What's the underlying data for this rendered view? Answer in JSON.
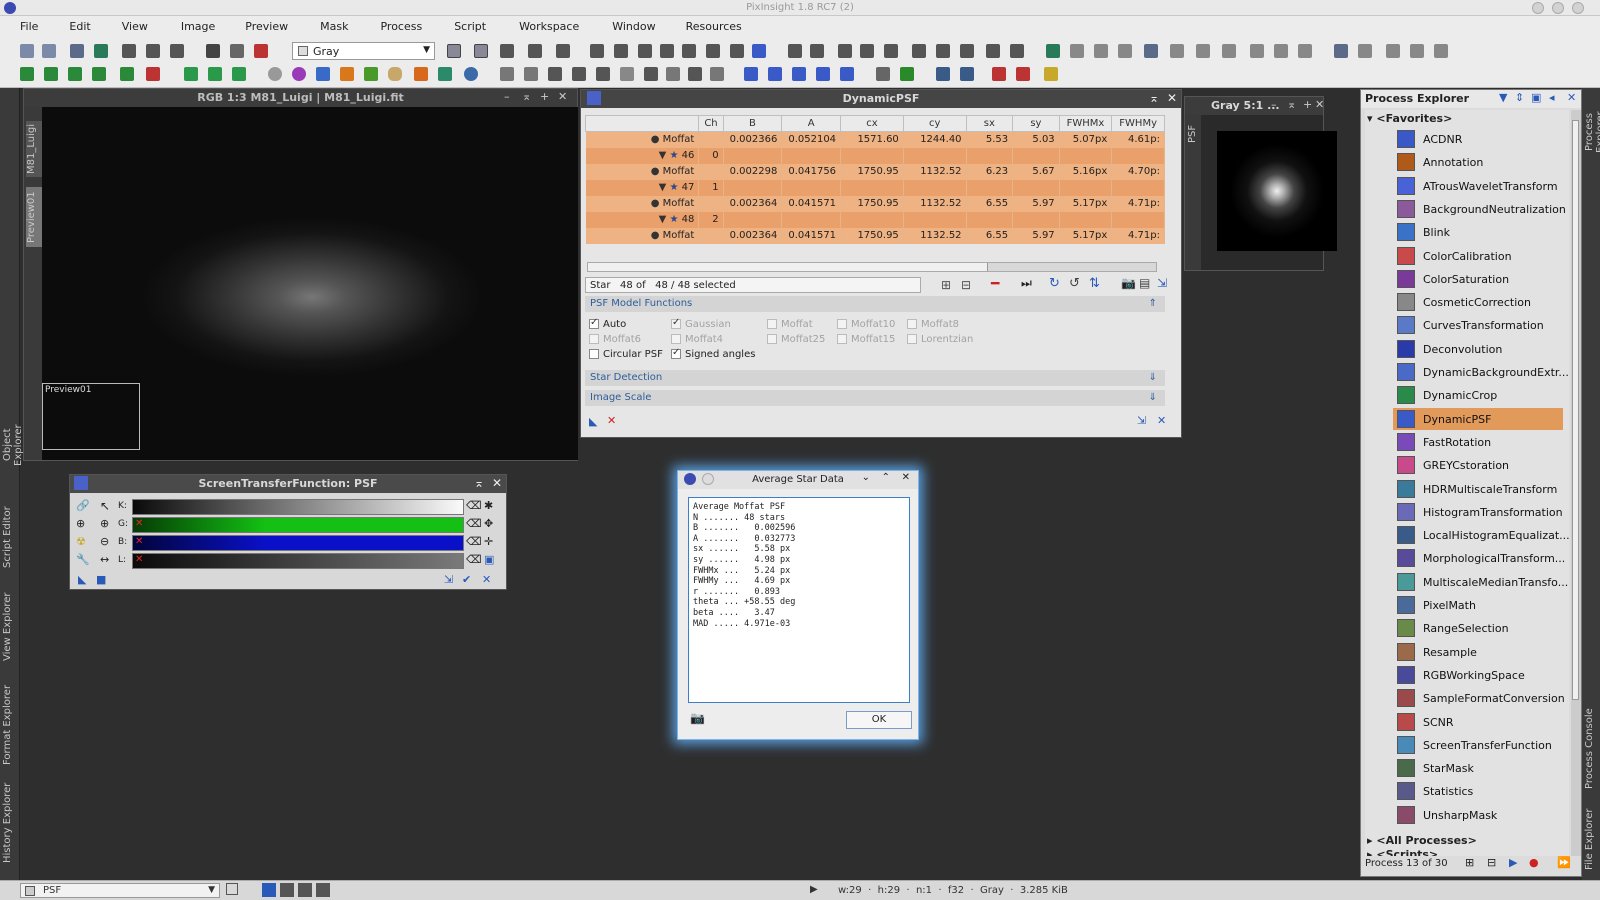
{
  "app": {
    "title": "PixInsight 1.8 RC7 (2)"
  },
  "menu": [
    "File",
    "Edit",
    "View",
    "Image",
    "Preview",
    "Mask",
    "Process",
    "Script",
    "Workspace",
    "Window",
    "Resources"
  ],
  "toolbar": {
    "color_space": "Gray"
  },
  "image_window": {
    "title": "RGB 1:3 M81_Luigi | M81_Luigi.fit",
    "tab_main": "M81_Luigi",
    "tab_preview": "Preview01",
    "preview_label": "Preview01"
  },
  "left_dock": [
    "Object Explorer",
    "Script Editor",
    "View Explorer",
    "Format Explorer",
    "History Explorer"
  ],
  "right_dock": [
    "Process Explorer",
    "Process Console",
    "File Explorer"
  ],
  "stf": {
    "title": "ScreenTransferFunction: PSF",
    "rows": [
      {
        "label": "K:"
      },
      {
        "label": "G:"
      },
      {
        "label": "B:"
      },
      {
        "label": "L:"
      }
    ],
    "colors": {
      "K": "#1a1a1a",
      "G": "#13c013",
      "B": "#0a10c8",
      "L": "#1a1a1a"
    }
  },
  "dpsf": {
    "title": "DynamicPSF",
    "columns": [
      "",
      "Ch",
      "B",
      "A",
      "cx",
      "cy",
      "sx",
      "sy",
      "FWHMx",
      "FWHMy"
    ],
    "rows": [
      {
        "kind": "data",
        "func": "Moffat",
        "B": "0.002366",
        "A": "0.052104",
        "cx": "1571.60",
        "cy": "1244.40",
        "sx": "5.53",
        "sy": "5.03",
        "fx": "5.07px",
        "fy": "4.61p:"
      },
      {
        "kind": "star",
        "id": "46",
        "ch": "0"
      },
      {
        "kind": "data",
        "func": "Moffat",
        "B": "0.002298",
        "A": "0.041756",
        "cx": "1750.95",
        "cy": "1132.52",
        "sx": "6.23",
        "sy": "5.67",
        "fx": "5.16px",
        "fy": "4.70p:"
      },
      {
        "kind": "star",
        "id": "47",
        "ch": "1"
      },
      {
        "kind": "data",
        "func": "Moffat",
        "B": "0.002364",
        "A": "0.041571",
        "cx": "1750.95",
        "cy": "1132.52",
        "sx": "6.55",
        "sy": "5.97",
        "fx": "5.17px",
        "fy": "4.71p:"
      },
      {
        "kind": "star",
        "id": "48",
        "ch": "2"
      },
      {
        "kind": "data",
        "func": "Moffat",
        "B": "0.002364",
        "A": "0.041571",
        "cx": "1750.95",
        "cy": "1132.52",
        "sx": "6.55",
        "sy": "5.97",
        "fx": "5.17px",
        "fy": "4.71p:"
      }
    ],
    "status": "Star   48 of   48 / 48 selected",
    "sections": {
      "model": "PSF Model Functions",
      "detection": "Star Detection",
      "scale": "Image Scale"
    },
    "options": {
      "auto": "Auto",
      "gaussian": "Gaussian",
      "moffat": "Moffat",
      "moffat10": "Moffat10",
      "moffat8": "Moffat8",
      "moffat6": "Moffat6",
      "moffat4": "Moffat4",
      "moffat25": "Moffat25",
      "moffat15": "Moffat15",
      "lorentzian": "Lorentzian",
      "circular": "Circular PSF",
      "signed": "Signed angles"
    }
  },
  "gray_window": {
    "title": "Gray 5:1 ...",
    "tab": "PSF"
  },
  "avg_dialog": {
    "title": "Average Star Data",
    "lines": [
      "Average Moffat PSF",
      "N ....... 48 stars",
      "B .......   0.002596",
      "A .......   0.032773",
      "sx ......   5.58 px",
      "sy ......   4.98 px",
      "FWHMx ...   5.24 px",
      "FWHMy ...   4.69 px",
      "r .......   0.893",
      "theta ... +58.55 deg",
      "beta ....   3.47",
      "MAD ..... 4.971e-03"
    ],
    "ok": "OK"
  },
  "process_explorer": {
    "title": "Process Explorer",
    "favorites": "<Favorites>",
    "items": [
      "ACDNR",
      "Annotation",
      "ATrousWaveletTransform",
      "BackgroundNeutralization",
      "Blink",
      "ColorCalibration",
      "ColorSaturation",
      "CosmeticCorrection",
      "CurvesTransformation",
      "Deconvolution",
      "DynamicBackgroundExtr...",
      "DynamicCrop",
      "DynamicPSF",
      "FastRotation",
      "GREYCstoration",
      "HDRMultiscaleTransform",
      "HistogramTransformation",
      "LocalHistogramEqualizat...",
      "MorphologicalTransform...",
      "MultiscaleMedianTransfo...",
      "PixelMath",
      "RangeSelection",
      "Resample",
      "RGBWorkingSpace",
      "SampleFormatConversion",
      "SCNR",
      "ScreenTransferFunction",
      "StarMask",
      "Statistics",
      "UnsharpMask"
    ],
    "icon_colors": [
      "#3a58c8",
      "#b05a1a",
      "#4a62d8",
      "#8a5a9a",
      "#3a72c8",
      "#c84a4a",
      "#7a3a9a",
      "#888888",
      "#5a7ac8",
      "#2a3aa8",
      "#4a6ac8",
      "#2a8a4a",
      "#3a5ac8",
      "#7a4ab8",
      "#c84a8a",
      "#3a7a9a",
      "#6a6ab8",
      "#3a5a8a",
      "#5a4a9a",
      "#4a9a9a",
      "#4a6a9a",
      "#6a8a4a",
      "#9a6a4a",
      "#4a4a9a",
      "#9a4a4a",
      "#b84a4a",
      "#4a8ab8",
      "#4a6a4a",
      "#5a5a8a",
      "#8a4a6a"
    ],
    "selected": "DynamicPSF",
    "all": "<All Processes>",
    "scripts": "<Scripts>",
    "footer": "Process 13 of 30"
  },
  "statusbar": {
    "view": "PSF",
    "info": "w:29  ·  h:29  ·  n:1  ·  f32  ·  Gray  ·  3.285 KiB"
  }
}
